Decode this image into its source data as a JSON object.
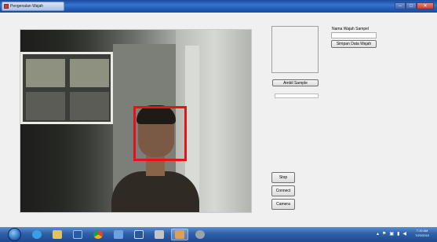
{
  "window": {
    "title": "Pengenalan Wajah",
    "controls": {
      "minimize": "–",
      "maximize": "□",
      "close": "✕"
    }
  },
  "video": {
    "face_detected": true,
    "face_box_color": "#e8101a"
  },
  "right_panel": {
    "ambil_sample_label": "Ambil Sample",
    "sample_progress": 0.0,
    "nama_wajah_label": "Nama Wajah Sampel",
    "nama_wajah_value": "",
    "simpan_label": "Simpan Data Wajah"
  },
  "control_buttons": {
    "stop_label": "Stop",
    "connect_label": "Connect",
    "camera_label": "Camera"
  },
  "taskbar": {
    "items": [
      "start-orb",
      "internet-explorer",
      "file-explorer",
      "media-player",
      "chrome",
      "app-icon-5",
      "word",
      "app-icon-7",
      "app-icon-8",
      "app-icon-9"
    ],
    "tray_icons": [
      "show-hidden-icon",
      "flag-icon",
      "shield-icon",
      "network-icon",
      "volume-icon"
    ],
    "clock_time": "7:19 AM",
    "clock_date": "7/20/2015"
  },
  "colors": {
    "titlebar": "#2861bd",
    "taskbar": "#2f5fa8",
    "accent_red": "#e8101a"
  }
}
